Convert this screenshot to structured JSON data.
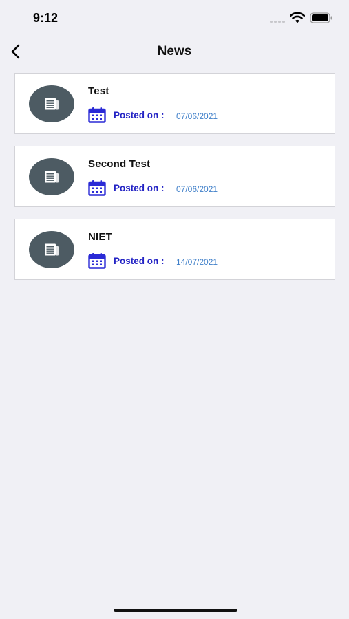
{
  "status_bar": {
    "time": "9:12"
  },
  "nav": {
    "title": "News"
  },
  "posted_label": "Posted on :",
  "news": [
    {
      "title": "Test",
      "date": "07/06/2021"
    },
    {
      "title": "Second Test",
      "date": "07/06/2021"
    },
    {
      "title": "NIET",
      "date": "14/07/2021"
    }
  ],
  "icons": {
    "back": "chevron-left-icon",
    "news": "newspaper-icon",
    "calendar": "calendar-icon"
  },
  "colors": {
    "background": "#f0f0f5",
    "avatar": "#4d5b63",
    "posted_label": "#2323c4",
    "date": "#3f7fc9",
    "calendar": "#2a2ad6"
  }
}
